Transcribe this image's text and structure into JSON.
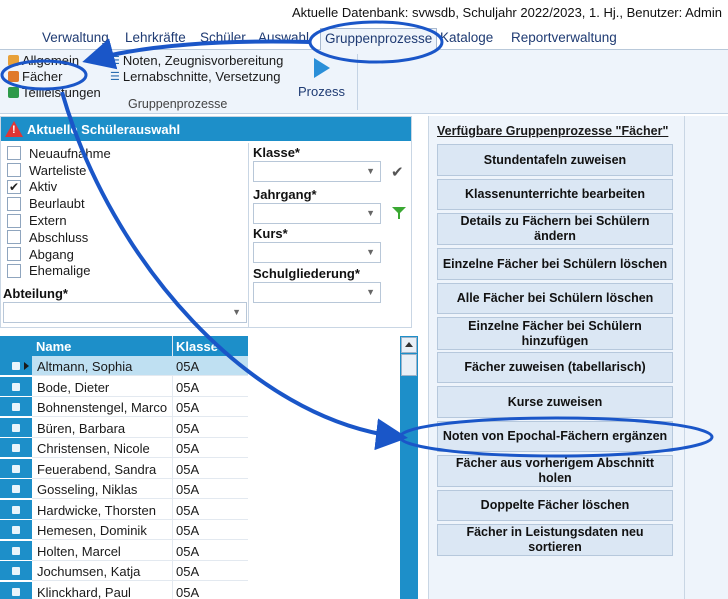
{
  "db_info": "Aktuelle Datenbank: svwsdb, Schuljahr 2022/2023, 1. Hj., Benutzer: Admin",
  "menu": {
    "items": [
      "Verwaltung",
      "Lehrkräfte",
      "Schüler",
      "Auswahl",
      "Gruppenprozesse",
      "Kataloge",
      "Reportverwaltung"
    ],
    "active": "Gruppenprozesse"
  },
  "ribbon": {
    "allgemein": "Allgemein",
    "faecher": "Fächer",
    "teilleistungen": "Teilleistungen",
    "noten": "Noten, Zeugnisvorbereitung",
    "lernabschnitte": "Lernabschnitte, Versetzung",
    "group_label": "Gruppenprozesse",
    "prozess": "Prozess"
  },
  "selection": {
    "title": "Aktuelle Schülerauswahl",
    "statuses": [
      {
        "label": "Neuaufnahme",
        "checked": false
      },
      {
        "label": "Warteliste",
        "checked": false
      },
      {
        "label": "Aktiv",
        "checked": true
      },
      {
        "label": "Beurlaubt",
        "checked": false
      },
      {
        "label": "Extern",
        "checked": false
      },
      {
        "label": "Abschluss",
        "checked": false
      },
      {
        "label": "Abgang",
        "checked": false
      },
      {
        "label": "Ehemalige",
        "checked": false
      }
    ],
    "abteilung_label": "Abteilung*",
    "klasse_label": "Klasse*",
    "jahrgang_label": "Jahrgang*",
    "kurs_label": "Kurs*",
    "schulgliederung_label": "Schulgliederung*",
    "checked_mark": "✔"
  },
  "grid": {
    "headers": {
      "name": "Name",
      "klasse": "Klasse"
    },
    "rows": [
      {
        "name": "Altmann, Sophia",
        "klasse": "05A"
      },
      {
        "name": "Bode, Dieter",
        "klasse": "05A"
      },
      {
        "name": "Bohnenstengel, Marco",
        "klasse": "05A"
      },
      {
        "name": "Büren, Barbara",
        "klasse": "05A"
      },
      {
        "name": "Christensen, Nicole",
        "klasse": "05A"
      },
      {
        "name": "Feuerabend, Sandra",
        "klasse": "05A"
      },
      {
        "name": "Gosseling, Niklas",
        "klasse": "05A"
      },
      {
        "name": "Hardwicke, Thorsten",
        "klasse": "05A"
      },
      {
        "name": "Hemesen, Dominik",
        "klasse": "05A"
      },
      {
        "name": "Holten, Marcel",
        "klasse": "05A"
      },
      {
        "name": "Jochumsen, Katja",
        "klasse": "05A"
      },
      {
        "name": "Klinckhard, Paul",
        "klasse": "05A"
      }
    ],
    "selected_index": 0
  },
  "processes": {
    "title": "Verfügbare Gruppenprozesse \"Fächer\"",
    "buttons": [
      "Stundentafeln zuweisen",
      "Klassenunterrichte bearbeiten",
      "Details zu Fächern bei Schülern ändern",
      "Einzelne Fächer bei Schülern löschen",
      "Alle Fächer bei Schülern löschen",
      "Einzelne Fächer bei Schülern hinzufügen",
      "Fächer zuweisen (tabellarisch)",
      "Kurse zuweisen",
      "Noten von Epochal-Fächern ergänzen",
      "Fächer aus vorherigem Abschnitt holen",
      "Doppelte Fächer löschen",
      "Fächer in Leistungsdaten neu sortieren"
    ]
  },
  "colors": {
    "accent": "#1d8fc9",
    "annotation": "#1a56c8"
  }
}
